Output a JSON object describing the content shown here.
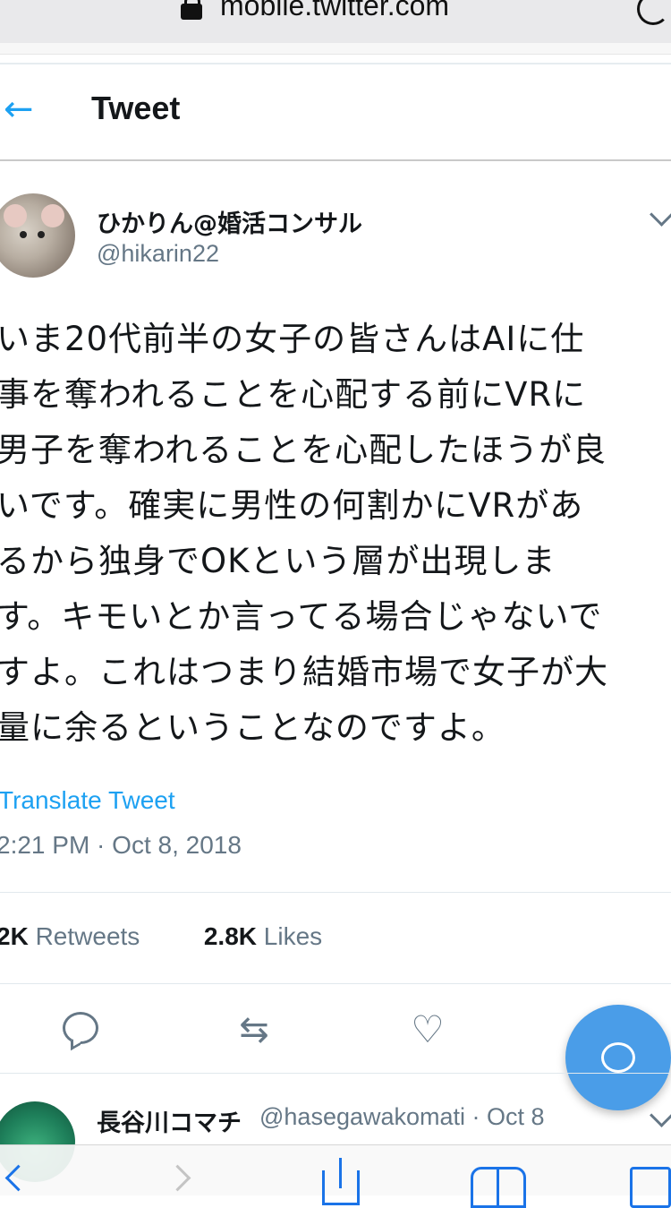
{
  "browser": {
    "url": "mobile.twitter.com"
  },
  "header": {
    "title": "Tweet"
  },
  "tweet": {
    "display_name": "ひかりん@婚活コンサル",
    "handle": "@hikarin22",
    "text_lines": [
      "いま20代前半の女子の皆さんはAIに仕",
      "事を奪われることを心配する前にVRに",
      "男子を奪われることを心配したほうが良",
      "いです。確実に男性の何割かにVRがあ",
      "るから独身でOKという層が出現しま",
      "す。キモいとか言ってる場合じゃないで",
      "すよ。これはつまり結婚市場で女子が大",
      "量に余るということなのですよ。"
    ],
    "translate_label": "Translate Tweet",
    "timestamp": "2:21 PM · Oct 8, 2018",
    "stats": {
      "retweets_count": "2K",
      "retweets_label": "Retweets",
      "likes_count": "2.8K",
      "likes_label": "Likes"
    }
  },
  "icons": {
    "back": "arrow-left-icon",
    "reply": "reply-icon",
    "retweet": "retweet-icon",
    "like": "heart-icon",
    "compose": "compose-reply-icon",
    "caret": "chevron-down-icon"
  },
  "reply": {
    "display_name": "長谷川コマチ",
    "meta": "@hasegawakomati · Oct 8"
  },
  "colors": {
    "accent": "#1da1f2",
    "fab": "#4a9de8",
    "secondary_text": "#657786"
  }
}
